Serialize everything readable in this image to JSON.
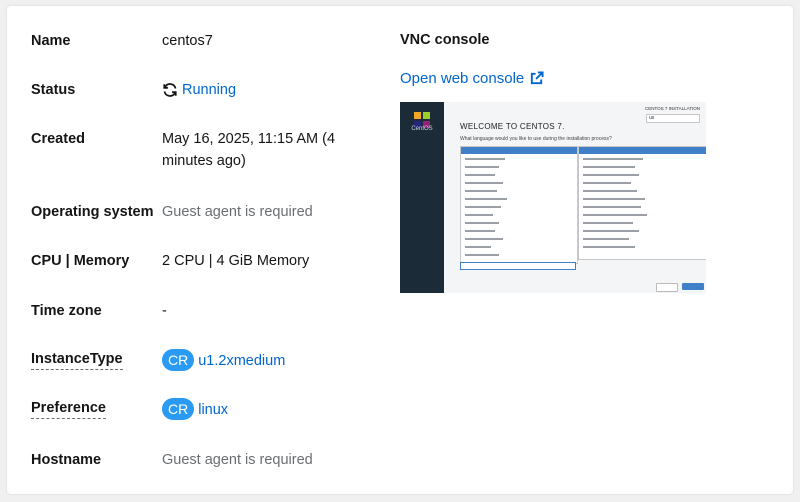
{
  "details": {
    "name": {
      "label": "Name",
      "value": "centos7"
    },
    "status": {
      "label": "Status",
      "value": "Running",
      "icon": "sync-icon"
    },
    "created": {
      "label": "Created",
      "value": "May 16, 2025, 11:15 AM (4 minutes ago)"
    },
    "os": {
      "label": "Operating system",
      "value": "Guest agent is required"
    },
    "cpu_memory": {
      "label": "CPU | Memory",
      "value": "2 CPU | 4 GiB Memory"
    },
    "timezone": {
      "label": "Time zone",
      "value": "-"
    },
    "instance_type": {
      "label": "InstanceType",
      "badge": "CR",
      "value": "u1.2xmedium"
    },
    "preference": {
      "label": "Preference",
      "badge": "CR",
      "value": "linux"
    },
    "hostname": {
      "label": "Hostname",
      "value": "Guest agent is required"
    }
  },
  "vnc": {
    "title": "VNC console",
    "open_label": "Open web console",
    "open_icon": "external-link-icon",
    "screenshot": {
      "heading": "WELCOME TO CENTOS 7.",
      "brand": "CentOS",
      "prompt": "What language would you like to use during the installation process?",
      "install_label": "CENTOS 7 INSTALLATION",
      "kbd_value": "us"
    }
  },
  "colors": {
    "link": "#0066cc",
    "badge": "#2b9af3",
    "muted": "#6a6e73"
  }
}
